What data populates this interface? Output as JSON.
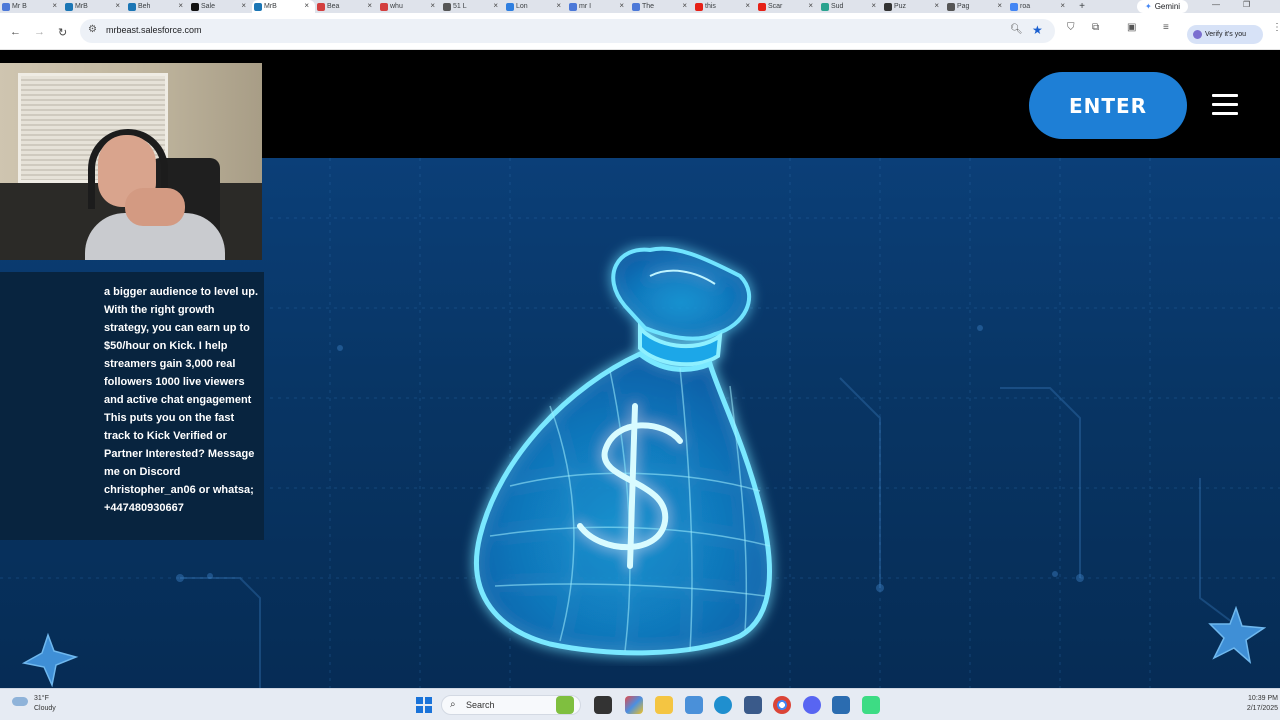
{
  "browser": {
    "tabs": [
      {
        "label": "Mr B",
        "color": "#4b78d8"
      },
      {
        "label": "MrB",
        "color": "#1b76b5"
      },
      {
        "label": "Beh",
        "color": "#1b76b5"
      },
      {
        "label": "Sale",
        "color": "#111111"
      },
      {
        "label": "MrB",
        "color": "#1b76b5",
        "active": true
      },
      {
        "label": "Bea",
        "color": "#d33f3f"
      },
      {
        "label": "whu",
        "color": "#d33f3f"
      },
      {
        "label": "51 L",
        "color": "#555555"
      },
      {
        "label": "Lon",
        "color": "#2f7fe0"
      },
      {
        "label": "mr I",
        "color": "#4b78d8"
      },
      {
        "label": "The",
        "color": "#4b78d8"
      },
      {
        "label": "this",
        "color": "#e62117"
      },
      {
        "label": "Scar",
        "color": "#e62117"
      },
      {
        "label": "Sud",
        "color": "#2aa38f"
      },
      {
        "label": "Puz",
        "color": "#333333"
      },
      {
        "label": "Pag",
        "color": "#555555"
      },
      {
        "label": "roa",
        "color": "#4285f4"
      }
    ],
    "new_tab": "+",
    "gemini_label": "Gemini",
    "url": "mrbeast.salesforce.com",
    "verify_label": "Verify it's you"
  },
  "page": {
    "enter_label": "ENTER"
  },
  "overlay": {
    "message": "a bigger audience to level up. With the right growth strategy, you can earn up to $50/hour on Kick. I help streamers gain 3,000 real followers 1000 live viewers and active chat engagement This puts you on the fast track to Kick Verified or Partner Interested? Message me on Discord christopher_an06 or whatsa; +447480930667"
  },
  "taskbar": {
    "weather_temp": "31°F",
    "weather_desc": "Cloudy",
    "search_placeholder": "Search",
    "time": "10:39 PM",
    "date": "2/17/2025"
  },
  "colors": {
    "enter_button": "#1e7fd6",
    "page_background": "#083564",
    "glow": "#4fd6ff"
  },
  "icons": [
    "back-icon",
    "forward-icon",
    "reload-icon",
    "site-settings-icon",
    "zoom-icon",
    "bookmark-star-icon",
    "hamburger-menu-icon",
    "money-bag-icon",
    "sparkle-icon",
    "windows-start-icon",
    "search-icon"
  ]
}
